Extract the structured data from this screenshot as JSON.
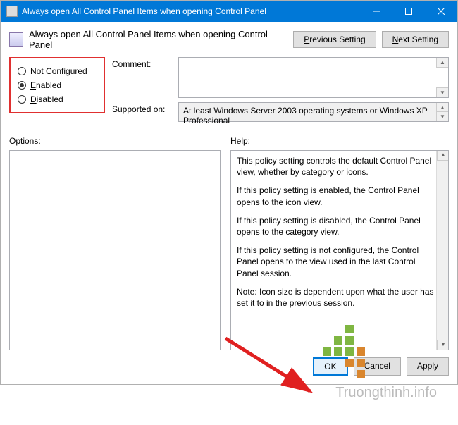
{
  "titlebar": {
    "text": "Always open All Control Panel Items when opening Control Panel"
  },
  "header": {
    "title": "Always open All Control Panel Items when opening Control Panel"
  },
  "nav": {
    "prev": "revious Setting",
    "prev_u": "P",
    "next": "ext Setting",
    "next_u": "N"
  },
  "radios": {
    "not_configured_u": "C",
    "not_configured_pre": "Not ",
    "not_configured_post": "onfigured",
    "enabled_u": "E",
    "enabled_post": "nabled",
    "disabled_u": "D",
    "disabled_post": "isabled",
    "selected": "enabled"
  },
  "labels": {
    "comment": "Comment:",
    "supported": "Supported on:",
    "options": "Options:",
    "help": "Help:"
  },
  "supported_text": "At least Windows Server 2003 operating systems or Windows XP Professional",
  "help": {
    "p1": "This policy setting controls the default Control Panel view, whether by category or icons.",
    "p2": "If this policy setting is enabled, the Control Panel opens to the icon view.",
    "p3": "If this policy setting is disabled, the Control Panel opens to the category view.",
    "p4": "If this policy setting is not configured, the Control Panel opens to the view used in the last Control Panel session.",
    "p5": "Note: Icon size is dependent upon what the user has set it to in the previous session."
  },
  "footer": {
    "ok": "OK",
    "cancel": "Cancel",
    "apply": "Apply"
  },
  "watermark": "Truongthinh.info"
}
